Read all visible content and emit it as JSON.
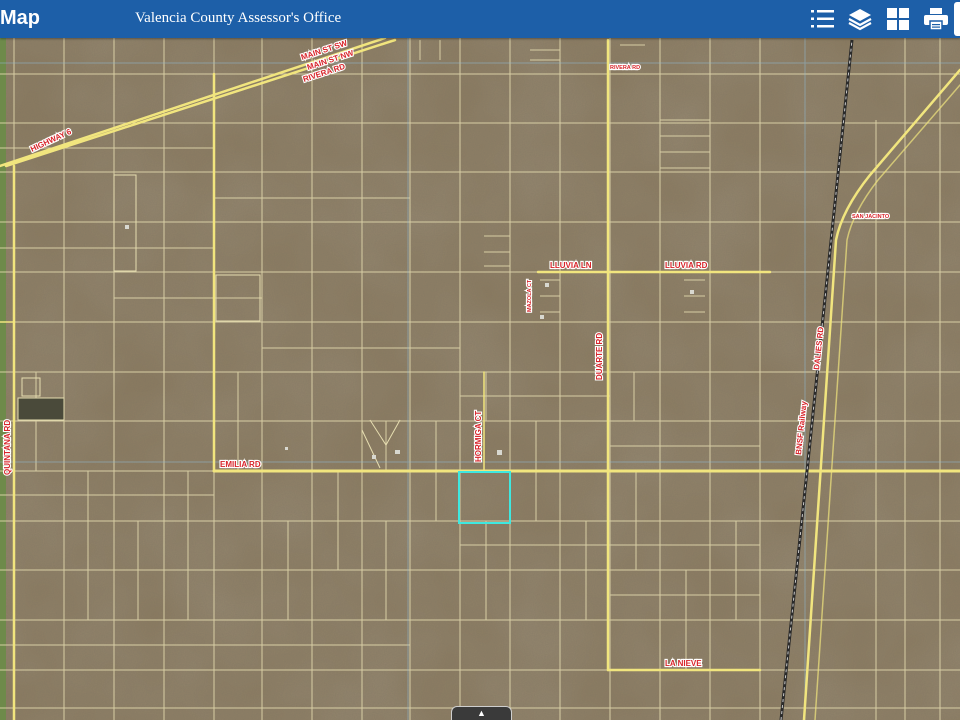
{
  "header": {
    "app_title": "Map",
    "subtitle": "Valencia County Assessor's Office"
  },
  "toolbar": {
    "buttons": [
      {
        "name": "legend",
        "icon": "list-icon"
      },
      {
        "name": "layers",
        "icon": "layers-icon"
      },
      {
        "name": "basemap",
        "icon": "grid-icon"
      },
      {
        "name": "print",
        "icon": "printer-icon"
      }
    ]
  },
  "map": {
    "road_labels": {
      "main_st_sw": "MAIN ST SW",
      "main_st_nw": "MAIN ST NW",
      "rivera_rd": "RIVERA RD",
      "rivera_rd_small": "RIVERA RD",
      "highway_6": "HIGHWAY 6",
      "san_jacinto": "SAN JACINTO",
      "lluvia_ln": "LLUVIA LN",
      "lluvia_rd": "LLUVIA RD",
      "mazola_ct": "MAZOLA CT",
      "duarte_rd": "DUARTE RD",
      "dalies_rd": "DALIES RD",
      "bnsf_railway": "BNSF Railway",
      "quintana_rd": "QUINTANA RD",
      "hormiga_ct": "HORMIGA CT",
      "emilia_rd": "EMILIA RD",
      "la_nieve": "LA NIEVE"
    },
    "colors": {
      "terrain": "#8a7a60",
      "parcel_lines": "#e8dfb2",
      "major_roads": "#f2e680",
      "selected_parcel": "#3ee8e0",
      "label_text": "#d8242a",
      "header": "#1d5fa8"
    }
  },
  "bottom": {
    "expand_icon": "caret-up-icon",
    "expand_glyph": "▲"
  }
}
